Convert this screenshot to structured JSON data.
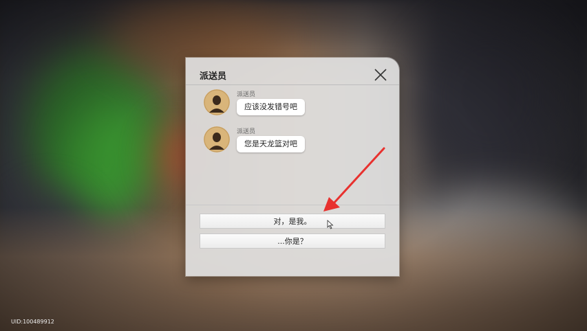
{
  "dialog": {
    "title": "派送员",
    "close_icon": "close-icon",
    "messages": [
      {
        "sender": "派送员",
        "text": "应该没发错号吧",
        "avatar_icon": "person-silhouette-icon"
      },
      {
        "sender": "派送员",
        "text": "您是天龙篮对吧",
        "avatar_icon": "person-silhouette-icon"
      }
    ],
    "choices": [
      {
        "label": "对，是我。"
      },
      {
        "label": "...你是？"
      }
    ]
  },
  "hud": {
    "uid": "UID:100489912"
  },
  "colors": {
    "arrow": "#e8312e",
    "avatar": "#d9b57a",
    "dialog_bg": "#e1e1e1"
  }
}
